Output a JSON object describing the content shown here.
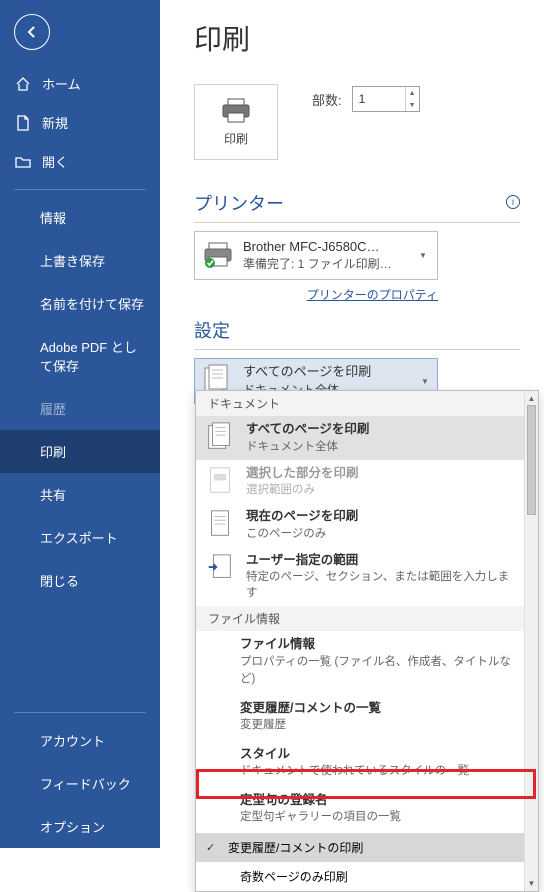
{
  "title": "印刷",
  "sidebar": {
    "items": [
      {
        "label": "ホーム"
      },
      {
        "label": "新規"
      },
      {
        "label": "開く"
      },
      {
        "label": "情報"
      },
      {
        "label": "上書き保存"
      },
      {
        "label": "名前を付けて保存"
      },
      {
        "label": "Adobe PDF として保存"
      },
      {
        "label": "履歴"
      },
      {
        "label": "印刷"
      },
      {
        "label": "共有"
      },
      {
        "label": "エクスポート"
      },
      {
        "label": "閉じる"
      }
    ],
    "bottom": [
      {
        "label": "アカウント"
      },
      {
        "label": "フィードバック"
      },
      {
        "label": "オプション"
      }
    ]
  },
  "print_tile": {
    "label": "印刷"
  },
  "copies": {
    "label": "部数:",
    "value": "1"
  },
  "section_printer": {
    "title": "プリンター"
  },
  "printer": {
    "name": "Brother MFC-J6580C…",
    "status": "準備完了: 1 ファイル印刷…"
  },
  "printer_properties_link": "プリンターのプロパティ",
  "section_settings": {
    "title": "設定"
  },
  "page_range": {
    "line1": "すべてのページを印刷",
    "line2": "ドキュメント全体"
  },
  "dropdown": {
    "group_document": "ドキュメント",
    "items": [
      {
        "t1": "すべてのページを印刷",
        "t2": "ドキュメント全体"
      },
      {
        "t1": "選択した部分を印刷",
        "t2": "選択範囲のみ"
      },
      {
        "t1": "現在のページを印刷",
        "t2": "このページのみ"
      },
      {
        "t1": "ユーザー指定の範囲",
        "t2": "特定のページ、セクション、または範囲を入力します"
      }
    ],
    "group_fileinfo": "ファイル情報",
    "fileinfo": [
      {
        "t1": "ファイル情報",
        "t2": "プロパティの一覧 (ファイル名、作成者、タイトルなど)"
      },
      {
        "t1": "変更履歴/コメントの一覧",
        "t2": "変更履歴"
      },
      {
        "t1": "スタイル",
        "t2": "ドキュメントで使われているスタイルの一覧"
      },
      {
        "t1": "定型句の登録名",
        "t2": "定型句ギャラリーの項目の一覧"
      }
    ],
    "check_item": "変更履歴/コメントの印刷",
    "plain_item": "奇数ページのみ印刷"
  }
}
